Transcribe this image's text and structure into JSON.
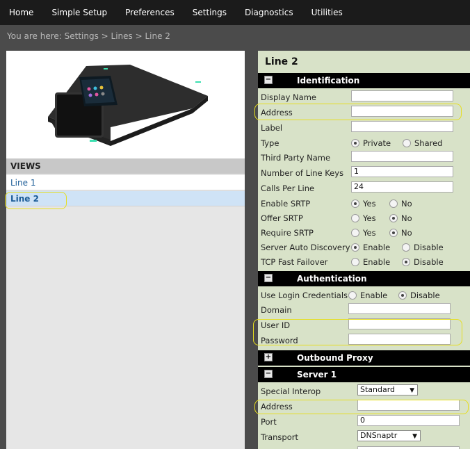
{
  "nav": [
    "Home",
    "Simple Setup",
    "Preferences",
    "Settings",
    "Diagnostics",
    "Utilities"
  ],
  "breadcrumb": "You are here: Settings > Lines > Line 2",
  "views": {
    "heading": "VIEWS",
    "items": [
      "Line 1",
      "Line 2"
    ],
    "selected": "Line 2"
  },
  "page_title": "Line 2",
  "sections": {
    "identification": {
      "title": "Identification",
      "toggle": "−",
      "display_name_label": "Display Name",
      "display_name": "",
      "address_label": "Address",
      "address": "",
      "label_label": "Label",
      "label": "",
      "type_label": "Type",
      "type_private": "Private",
      "type_shared": "Shared",
      "third_party_label": "Third Party Name",
      "third_party": "",
      "line_keys_label": "Number of Line Keys",
      "line_keys": "1",
      "calls_label": "Calls Per Line",
      "calls": "24",
      "enable_srtp_label": "Enable SRTP",
      "offer_srtp_label": "Offer SRTP",
      "require_srtp_label": "Require SRTP",
      "yes": "Yes",
      "no": "No",
      "server_auto_label": "Server Auto Discovery",
      "tcp_label": "TCP Fast Failover",
      "enable": "Enable",
      "disable": "Disable"
    },
    "authentication": {
      "title": "Authentication",
      "toggle": "−",
      "login_label": "Use Login Credentials",
      "enable": "Enable",
      "disable": "Disable",
      "domain_label": "Domain",
      "domain": "",
      "userid_label": "User ID",
      "userid": "",
      "password_label": "Password",
      "password": ""
    },
    "outbound_proxy": {
      "title": "Outbound Proxy",
      "toggle": "+"
    },
    "server1": {
      "title": "Server 1",
      "toggle": "−",
      "interop_label": "Special Interop",
      "interop": "Standard",
      "address_label": "Address",
      "address": "",
      "port_label": "Port",
      "port": "0",
      "transport_label": "Transport",
      "transport": "DNSnaptr"
    }
  },
  "colors": {
    "nav_bg": "#1b1b1b",
    "panel_bg": "#d8e2c8",
    "section_bg": "#000000",
    "link": "#1a5b96",
    "selected_bg": "#cfe3f6",
    "highlight": "#e6de1e"
  }
}
